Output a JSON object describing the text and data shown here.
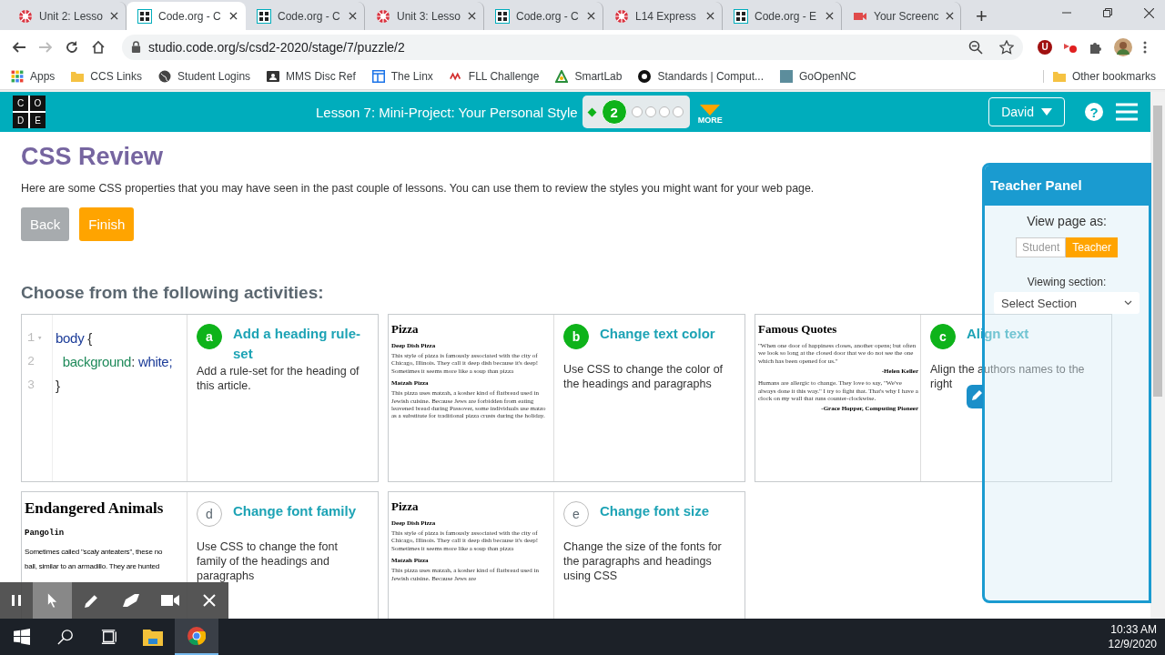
{
  "browser": {
    "tabs": [
      {
        "kind": "wheel",
        "title": "Unit 2: Lesso",
        "selected": false
      },
      {
        "kind": "grid",
        "title": "Code.org - C",
        "selected": true
      },
      {
        "kind": "grid",
        "title": "Code.org - C",
        "selected": false
      },
      {
        "kind": "wheel",
        "title": "Unit 3: Lesso",
        "selected": false
      },
      {
        "kind": "grid",
        "title": "Code.org - C",
        "selected": false
      },
      {
        "kind": "wheel",
        "title": "L14 Express",
        "selected": false
      },
      {
        "kind": "grid",
        "title": "Code.org - E",
        "selected": false
      },
      {
        "kind": "cast",
        "title": "Your Screenc",
        "selected": false
      }
    ],
    "new_tab": "+",
    "address": "studio.code.org/s/csd2-2020/stage/7/puzzle/2",
    "extension_badge": "U",
    "bookmarks": [
      {
        "kind": "apps",
        "label": "Apps"
      },
      {
        "kind": "folder",
        "label": "CCS Links"
      },
      {
        "kind": "globe",
        "label": "Student Logins"
      },
      {
        "kind": "contact",
        "label": "MMS Disc Ref"
      },
      {
        "kind": "linx",
        "label": "The Linx"
      },
      {
        "kind": "fll",
        "label": "FLL Challenge"
      },
      {
        "kind": "smartlab",
        "label": "SmartLab"
      },
      {
        "kind": "standards",
        "label": "Standards | Comput..."
      },
      {
        "kind": "square",
        "label": "GoOpenNC"
      }
    ],
    "other_bookmarks": "Other bookmarks"
  },
  "header": {
    "logo_letters": [
      "C",
      "O",
      "D",
      "E"
    ],
    "lesson_title": "Lesson 7: Mini-Project: Your Personal Style",
    "levels": [
      {
        "kind": "diamond",
        "selected": false
      },
      {
        "kind": "bubble",
        "label": "2",
        "selected": true
      },
      {
        "kind": "dot",
        "selected": false
      },
      {
        "kind": "dot",
        "selected": false
      },
      {
        "kind": "dot",
        "selected": false
      },
      {
        "kind": "dot",
        "selected": false
      }
    ],
    "more_label": "MORE",
    "user": "David",
    "help": "?"
  },
  "page": {
    "title": "CSS Review",
    "description": "Here are some CSS properties that you may have seen in the past couple of lessons. You can use them to review the styles you might want for your web page.",
    "buttons": [
      {
        "label": "Back",
        "disabled": true
      },
      {
        "label": "Finish",
        "disabled": false
      }
    ],
    "heading": "Choose from the following activities:",
    "activities": [
      {
        "letter": "a",
        "title": "Add a heading rule-set",
        "text": "Add a rule-set for the heading of this article.",
        "completed": true,
        "preview": {
          "kind": "code",
          "lines": [
            {
              "number": "1",
              "fold": "▾",
              "tokens": [
                {
                  "kind": "selector",
                  "text": "body"
                },
                {
                  "kind": "punct",
                  "text": " {"
                }
              ]
            },
            {
              "number": "2",
              "tokens": [
                {
                  "kind": "property",
                  "text": "  background"
                },
                {
                  "kind": "punct",
                  "text": ": "
                },
                {
                  "kind": "value",
                  "text": "white;"
                }
              ]
            },
            {
              "number": "3",
              "tokens": [
                {
                  "kind": "punct",
                  "text": "}"
                }
              ]
            }
          ]
        }
      },
      {
        "letter": "b",
        "title": "Change text color",
        "text": "Use CSS to change the color of the headings and paragraphs",
        "completed": true,
        "preview": {
          "kind": "article",
          "blocks": [
            {
              "kind": "h1",
              "text": "Pizza"
            },
            {
              "kind": "h2",
              "text": "Deep Dish Pizza"
            },
            {
              "kind": "p",
              "text": "This style of pizza is famously associated with the city of Chicago, Illinois. They call it deep dish because it's deep! Sometimes it seems more like a soup than pizza"
            },
            {
              "kind": "h2",
              "text": "Matzah Pizza"
            },
            {
              "kind": "p",
              "text": "This pizza uses matzah, a kosher kind of flatbread used in Jewish cuisine. Because Jews are forbidden from eating leavened bread during Passover, some individuals use matzo as a substitute for traditional pizza crusts during the holiday."
            }
          ]
        }
      },
      {
        "letter": "c",
        "title": "Align text",
        "text": "Align the authors names to the right",
        "completed": true,
        "preview": {
          "kind": "article",
          "blocks": [
            {
              "kind": "h1",
              "text": "Famous Quotes"
            },
            {
              "kind": "p",
              "text": "\"When one door of happiness closes, another opens; but often we look so long at the closed door that we do not see the one which has been opened for us.\""
            },
            {
              "kind": "attribution",
              "text": "-Helen Keller"
            },
            {
              "kind": "p",
              "text": "Humans are allergic to change. They love to say, \"We've always done it this way.\" I try to fight that. That's why I have a clock on my wall that runs counter-clockwise."
            },
            {
              "kind": "attribution",
              "text": "-Grace Hopper, Computing Pioneer"
            }
          ]
        }
      },
      {
        "letter": "d",
        "title": "Change font family",
        "text": "Use CSS to change the font family of the headings and paragraphs",
        "completed": false,
        "preview": {
          "kind": "article",
          "blocks": [
            {
              "kind": "h1-large",
              "text": "Endangered Animals"
            },
            {
              "kind": "h2-mono",
              "text": "Pangolin"
            },
            {
              "kind": "line",
              "text": "Sometimes called \"scaly anteaters\", these no"
            },
            {
              "kind": "line",
              "text": "ball, similar to an armadillo. They are hunted"
            }
          ]
        }
      },
      {
        "letter": "e",
        "title": "Change font size",
        "text": "Change the size of the fonts for the paragraphs and headings using CSS",
        "completed": false,
        "preview": {
          "kind": "article",
          "blocks": [
            {
              "kind": "h1",
              "text": "Pizza"
            },
            {
              "kind": "h2",
              "text": "Deep Dish Pizza"
            },
            {
              "kind": "p",
              "text": "This style of pizza is famously associated with the city of Chicago, Illinois. They call it deep dish because it's deep! Sometimes it seems more like a soup than pizza"
            },
            {
              "kind": "h2",
              "text": "Matzah Pizza"
            },
            {
              "kind": "p",
              "text": "This pizza uses matzah, a kosher kind of flatbread used in Jewish cuisine. Because Jews are"
            }
          ]
        }
      }
    ]
  },
  "teacher_panel": {
    "title": "Teacher Panel",
    "view_label": "View page as:",
    "view_options": [
      {
        "label": "Student",
        "selected": false
      },
      {
        "label": "Teacher",
        "selected": true
      }
    ],
    "section_label": "Viewing section:",
    "section_value": "Select Section"
  },
  "recorder": [
    {
      "kind": "pause",
      "selected": false
    },
    {
      "kind": "pointer",
      "selected": true
    },
    {
      "kind": "pen",
      "selected": false
    },
    {
      "kind": "eraser",
      "selected": false
    },
    {
      "kind": "camera",
      "selected": false
    },
    {
      "kind": "close",
      "selected": false
    }
  ],
  "taskbar": {
    "items": [
      {
        "kind": "start",
        "selected": false
      },
      {
        "kind": "search",
        "selected": false
      },
      {
        "kind": "taskview",
        "selected": false
      },
      {
        "kind": "explorer",
        "selected": false
      },
      {
        "kind": "chrome",
        "selected": true
      }
    ],
    "time": "10:33 AM",
    "date": "12/9/2020"
  }
}
